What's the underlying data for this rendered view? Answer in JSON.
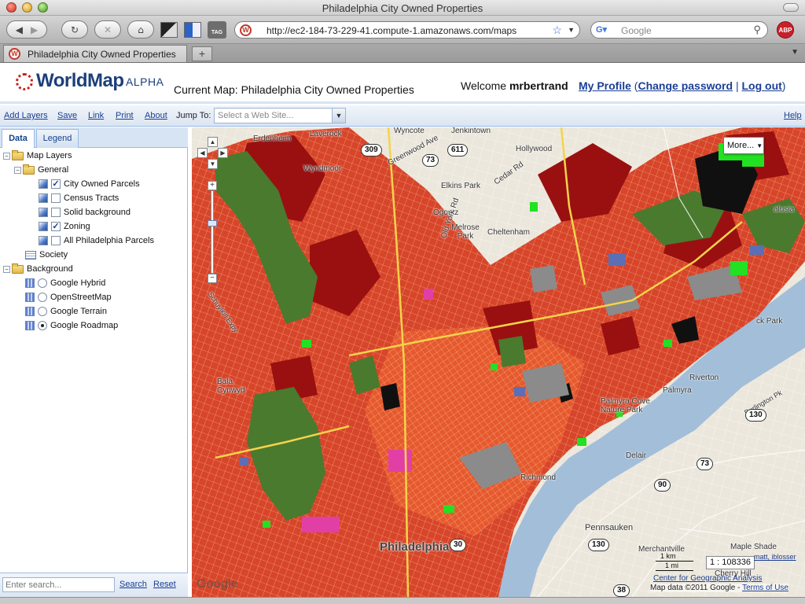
{
  "window": {
    "title": "Philadelphia City Owned Properties"
  },
  "browser": {
    "back_glyph": "◀",
    "forward_glyph": "▶",
    "reload_glyph": "↻",
    "stop_glyph": "✕",
    "home_glyph": "⌂",
    "url": "http://ec2-184-73-229-41.compute-1.amazonaws.com/maps",
    "search_placeholder": "Google",
    "abp_label": "ABP",
    "tag_label": "TAG",
    "tab_title": "Philadelphia City Owned Properties",
    "new_tab": "+"
  },
  "header": {
    "logo": "WorldMap",
    "logo_suffix": "ALPHA",
    "current_map": "Current Map: Philadelphia City Owned Properties",
    "welcome_prefix": "Welcome",
    "username": "mrbertrand",
    "my_profile": "My Profile",
    "change_password": "Change password",
    "log_out": "Log out",
    "sep_open": "(",
    "sep_bar": "|",
    "sep_close": ")"
  },
  "toolbar": {
    "add_layers": "Add Layers",
    "save": "Save",
    "link": "Link",
    "print": "Print",
    "about": "About",
    "jump_to": "Jump To:",
    "jump_placeholder": "Select a Web Site...",
    "help": "Help"
  },
  "panel": {
    "tabs": [
      "Data",
      "Legend"
    ],
    "tree": {
      "map_layers": "Map Layers",
      "general": "General",
      "general_items": [
        {
          "label": "City Owned Parcels",
          "checked": true
        },
        {
          "label": "Census Tracts",
          "checked": false
        },
        {
          "label": "Solid background",
          "checked": false
        },
        {
          "label": "Zoning",
          "checked": true
        },
        {
          "label": "All Philadelphia Parcels",
          "checked": false
        }
      ],
      "society": "Society",
      "background": "Background",
      "background_items": [
        {
          "label": "Google Hybrid",
          "selected": false
        },
        {
          "label": "OpenStreetMap",
          "selected": false
        },
        {
          "label": "Google Terrain",
          "selected": false
        },
        {
          "label": "Google Roadmap",
          "selected": true
        }
      ]
    },
    "search_placeholder": "Enter search...",
    "search": "Search",
    "reset": "Reset"
  },
  "map": {
    "more": "More...",
    "labels": {
      "wyncote": "Wyncote",
      "jenkintown": "Jenkintown",
      "erdenheim": "Erdenheim",
      "laverock": "Laverock",
      "hollywood": "Hollywood",
      "wyndmoor": "Wyndmoor",
      "greenwood_ave": "Greenwood Ave",
      "elkins_park": "Elkins Park",
      "cedar_rd": "Cedar Rd",
      "ogontz": "Ogontz",
      "melrose_park": "Melrose Park",
      "old_york_rd": "Old York Rd",
      "cheltenham": "Cheltenham",
      "palmyra": "Palmyra",
      "riverton": "Riverton",
      "bala_cynwyd": "Bala Cynwyd",
      "palmyra_cove": "Palmyra Cove Nature Park",
      "delair": "Delair",
      "richmond": "Richmond",
      "pennsauken": "Pennsauken",
      "merchantville": "Merchantville",
      "maple_shade": "Maple Shade",
      "cherry_hill": "Cherry Hill",
      "philadelphia": "Philadelphia",
      "alusia": "alusia",
      "ck_park": "ck Park",
      "burlington": "Burlington Pk",
      "schuylkill": "Schuylkill Expy"
    },
    "shields": [
      "309",
      "611",
      "73",
      "130",
      "73",
      "90",
      "130",
      "30",
      "38"
    ],
    "scale_km": "1 km",
    "scale_mi": "1 mi",
    "scale_ratio": "1 : 108336",
    "attribution": "matt, iblosser",
    "cga_link": "Center for Geographic Analysis",
    "copyright": "Map data ©2011 Google - ",
    "terms": "Terms of Use",
    "google_logo": "Google",
    "colors": {
      "parcels_red": "#d7452a",
      "dark_red": "#9a1010",
      "park_green": "#4a7a2e",
      "bright_green": "#22e022",
      "water": "#a3bed9"
    }
  }
}
